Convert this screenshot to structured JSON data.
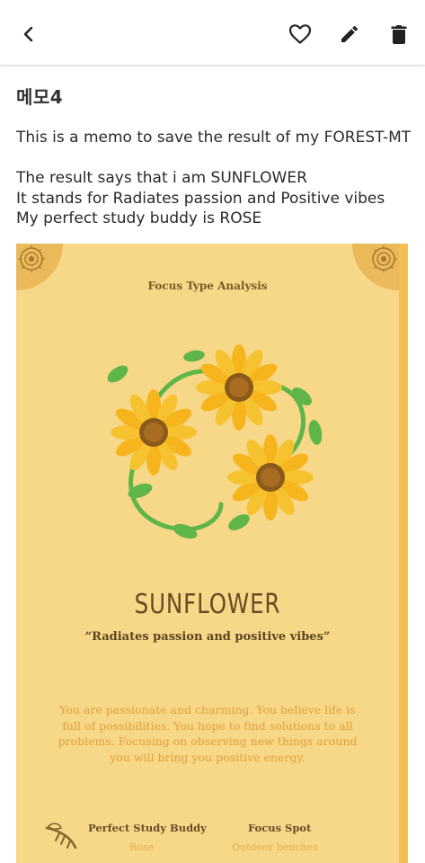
{
  "memo": {
    "title": "메모4",
    "body": "This is a memo to save the result of my FOREST-MT\n\nThe result says that i am SUNFLOWER\nIt stands for Radiates passion and Positive vibes\nMy perfect study buddy is ROSE"
  },
  "card": {
    "subtitle": "Focus Type Analysis",
    "name": "SUNFLOWER",
    "tagline": "“Radiates passion and positive vibes”",
    "description": "You are passionate and charming. You believe life is full of possibilities. You hope to find solutions to all problems. Focusing on observing new things around you will bring you positive energy.",
    "buddy_label": "Perfect Study Buddy",
    "buddy_value": "Rose",
    "spot_label": "Focus Spot",
    "spot_value": "Outdoor benches"
  },
  "icons": [
    "back-arrow-icon",
    "heart-icon",
    "pencil-icon",
    "trash-icon"
  ],
  "colors": {
    "card_background": "#f7d788",
    "card_accent": "#f3bf55",
    "petal": "#f6b51c",
    "leaf": "#5fb548"
  }
}
